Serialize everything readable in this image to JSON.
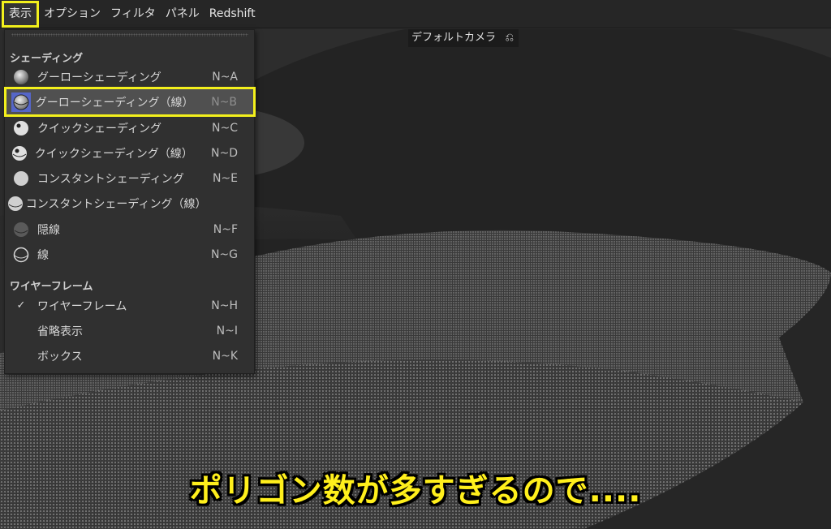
{
  "menubar": {
    "items": [
      "表示",
      "オプション",
      "フィルタ",
      "パネル",
      "Redshift"
    ]
  },
  "viewport": {
    "camera_label": "デフォルトカメラ",
    "camera_icon": "camera-sync-icon"
  },
  "menu": {
    "shading_header": "シェーディング",
    "shading_items": [
      {
        "label": "グーローシェーディング",
        "shortcut": "N~A",
        "icon": "gouraud-shading-icon"
      },
      {
        "label": "グーローシェーディング（線）",
        "shortcut": "N~B",
        "icon": "gouraud-lines-icon",
        "selected": true
      },
      {
        "label": "クイックシェーディング",
        "shortcut": "N~C",
        "icon": "quick-shading-icon"
      },
      {
        "label": "クイックシェーディング（線）",
        "shortcut": "N~D",
        "icon": "quick-lines-icon"
      },
      {
        "label": "コンスタントシェーディング",
        "shortcut": "N~E",
        "icon": "constant-shading-icon"
      },
      {
        "label": "コンスタントシェーディング（線）",
        "shortcut": "",
        "icon": "constant-lines-icon"
      },
      {
        "label": "隠線",
        "shortcut": "N~F",
        "icon": "hidden-line-icon"
      },
      {
        "label": "線",
        "shortcut": "N~G",
        "icon": "lines-icon"
      }
    ],
    "wireframe_header": "ワイヤーフレーム",
    "wireframe_items": [
      {
        "label": "ワイヤーフレーム",
        "shortcut": "N~H",
        "checked": "✓"
      },
      {
        "label": "省略表示",
        "shortcut": "N~I",
        "checked": ""
      },
      {
        "label": "ボックス",
        "shortcut": "N~K",
        "checked": ""
      }
    ]
  },
  "caption": "ポリゴン数が多すぎるので....",
  "colors": {
    "highlight": "#f3f01c",
    "caption": "#ffef1c",
    "selected_bg": "#505050"
  }
}
